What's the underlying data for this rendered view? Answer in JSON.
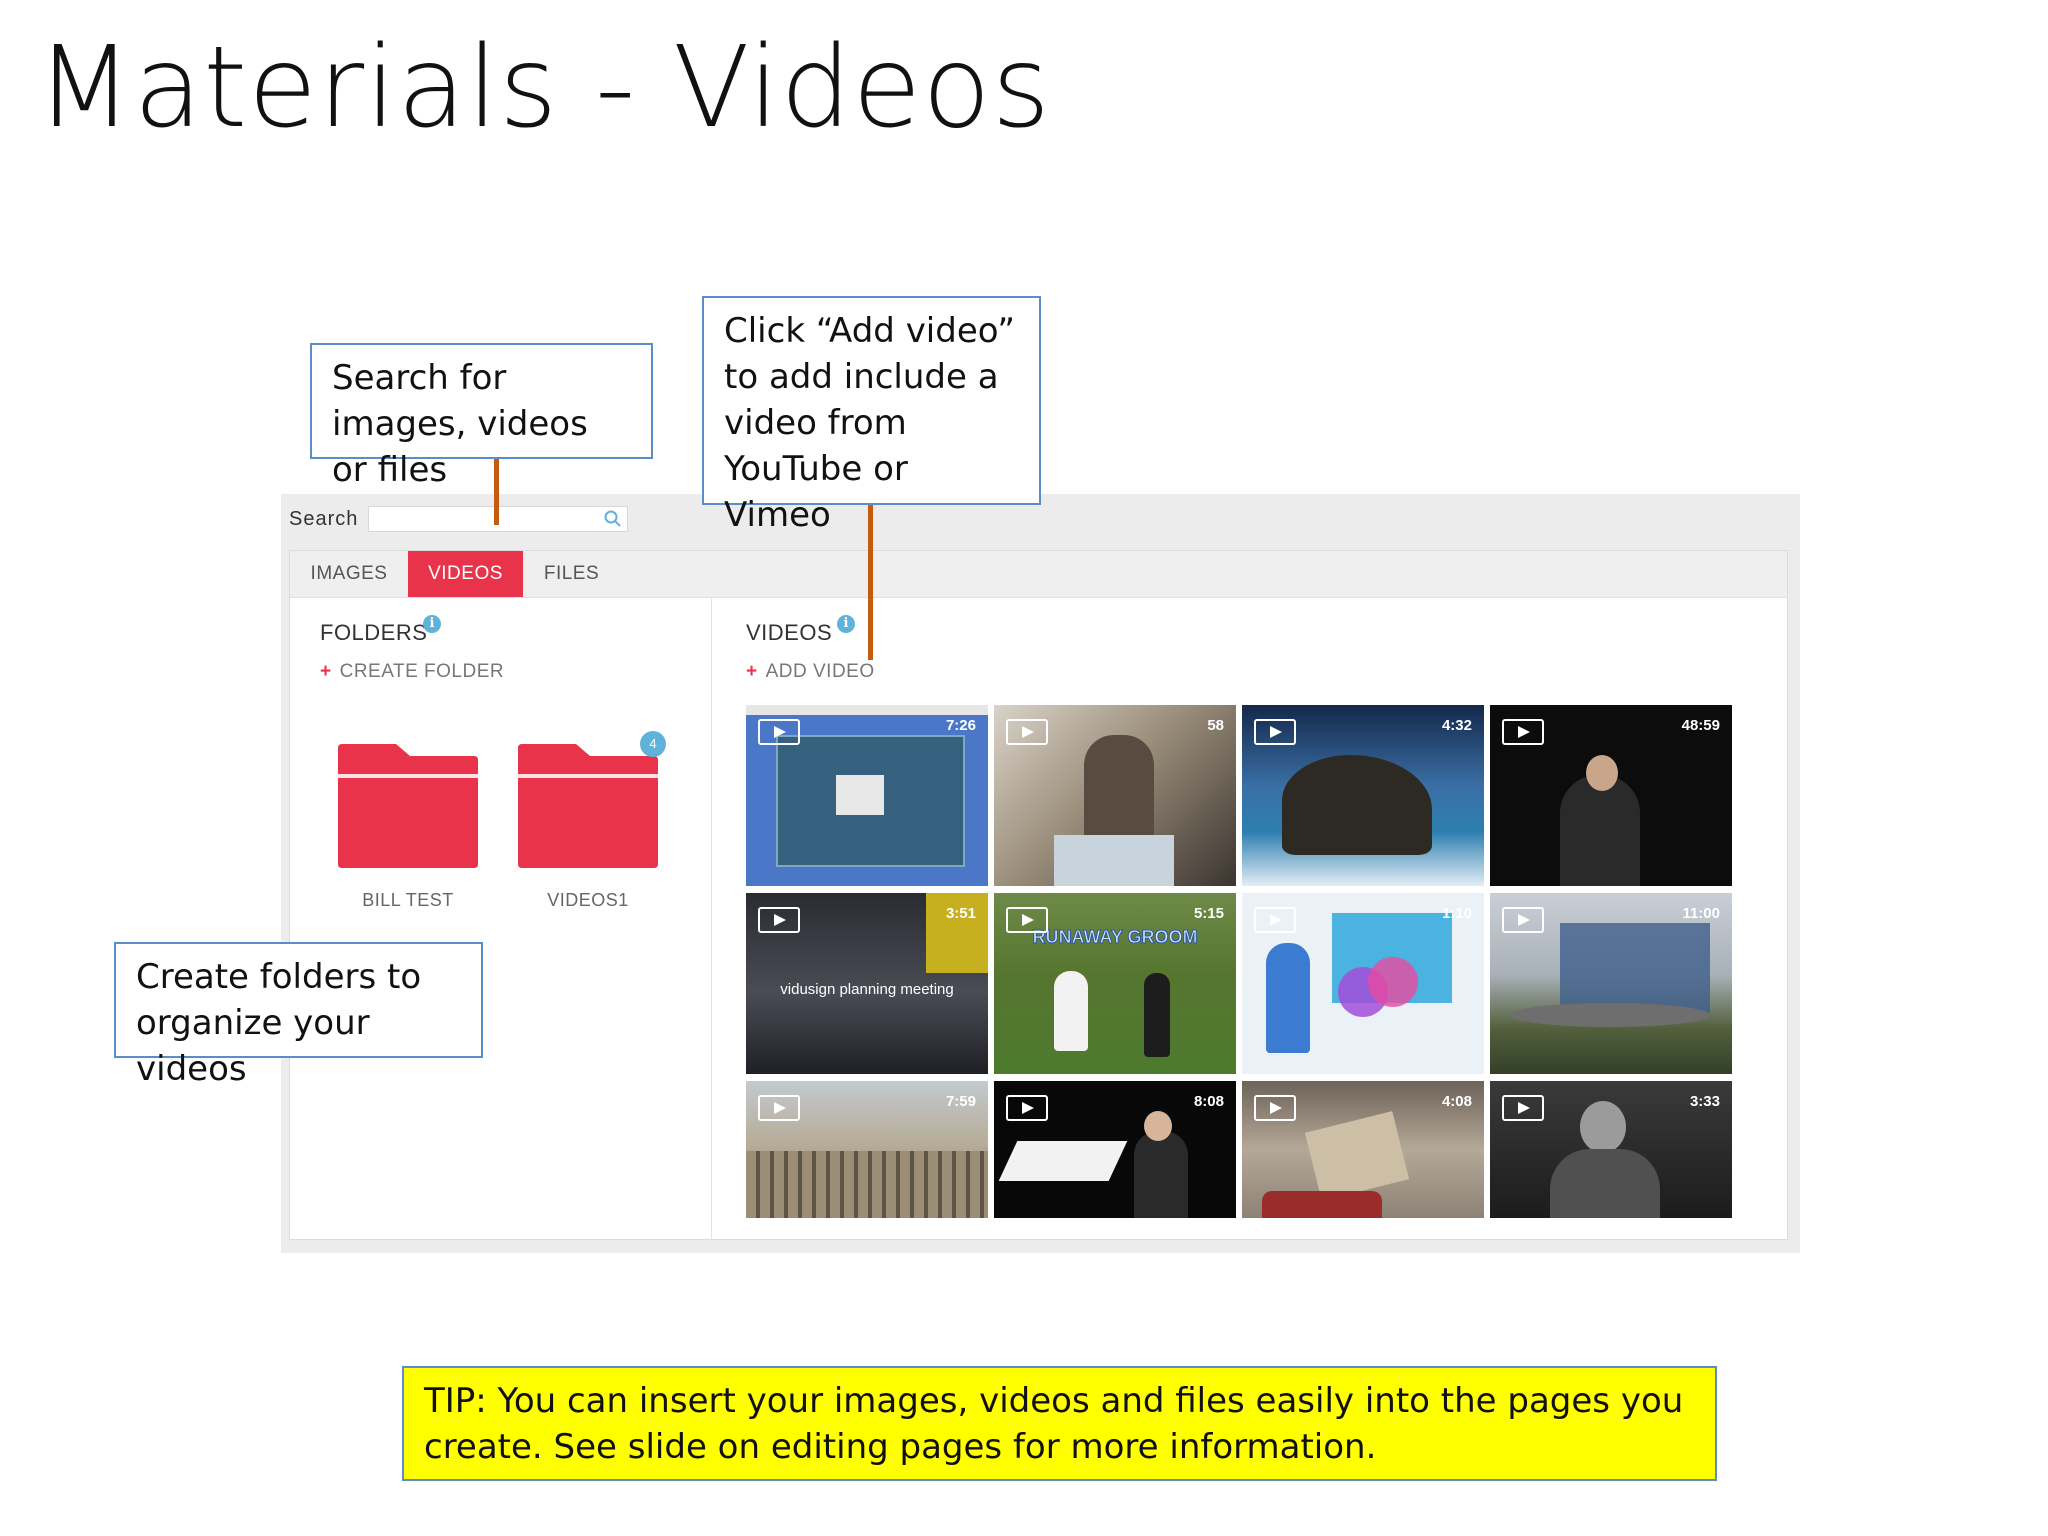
{
  "slide": {
    "title": "Materials - Videos"
  },
  "app": {
    "search": {
      "label": "Search",
      "value": ""
    },
    "tabs": [
      {
        "label": "IMAGES",
        "active": false
      },
      {
        "label": "VIDEOS",
        "active": true
      },
      {
        "label": "FILES",
        "active": false
      }
    ],
    "folders": {
      "title": "FOLDERS",
      "create_label": "CREATE FOLDER",
      "items": [
        {
          "label": "BILL TEST",
          "badge": ""
        },
        {
          "label": "VIDEOS1",
          "badge": "4"
        }
      ]
    },
    "videos": {
      "title": "VIDEOS",
      "add_label": "ADD VIDEO",
      "items": [
        {
          "duration": "7:26",
          "caption": ""
        },
        {
          "duration": "58",
          "caption": ""
        },
        {
          "duration": "4:32",
          "caption": ""
        },
        {
          "duration": "48:59",
          "caption": ""
        },
        {
          "duration": "3:51",
          "caption": "vidusign planning meeting"
        },
        {
          "duration": "5:15",
          "caption": "RUNAWAY GROOM"
        },
        {
          "duration": "1:10",
          "caption": ""
        },
        {
          "duration": "11:00",
          "caption": ""
        },
        {
          "duration": "7:59",
          "caption": ""
        },
        {
          "duration": "8:08",
          "caption": ""
        },
        {
          "duration": "4:08",
          "caption": ""
        },
        {
          "duration": "3:33",
          "caption": ""
        }
      ]
    }
  },
  "callouts": {
    "search": "Search for images, videos or files",
    "add_video": "Click “Add video” to add include a video from YouTube or Vimeo",
    "folders": "Create folders to organize your videos",
    "tip": "TIP: You can insert your images, videos and files easily into the pages you create. See slide on editing pages for more information."
  },
  "colors": {
    "accent": "#e8334a",
    "info": "#5fb3d8",
    "callout_border": "#5b8ec9",
    "connector": "#c55a11",
    "tip_background": "#ffff00"
  }
}
